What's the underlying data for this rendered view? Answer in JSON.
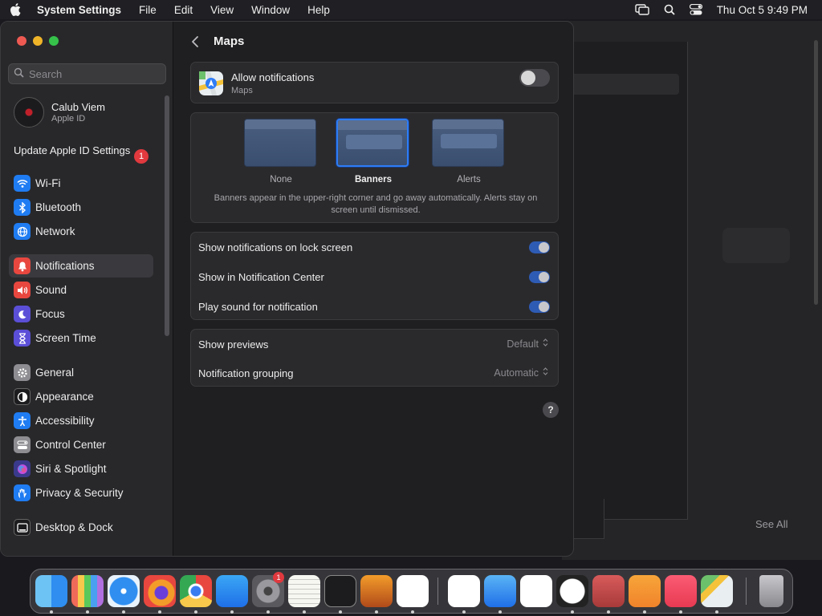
{
  "menubar": {
    "app_name": "System Settings",
    "menus": [
      "File",
      "Edit",
      "View",
      "Window",
      "Help"
    ],
    "clock": "Thu Oct 5  9:49 PM"
  },
  "background_window": {
    "see_all": "See All"
  },
  "sidebar": {
    "search_placeholder": "Search",
    "user": {
      "name": "Calub Viem",
      "subtitle": "Apple ID"
    },
    "update": {
      "label": "Update Apple ID Settings",
      "badge": "1"
    },
    "items": [
      {
        "label": "Wi-Fi",
        "icon": "wifi-icon",
        "color": "#1f7cf2"
      },
      {
        "label": "Bluetooth",
        "icon": "bluetooth-icon",
        "color": "#1f7cf2"
      },
      {
        "label": "Network",
        "icon": "globe-icon",
        "color": "#1f7cf2"
      },
      {
        "label": "Notifications",
        "icon": "bell-icon",
        "color": "#e8473f",
        "selected": true
      },
      {
        "label": "Sound",
        "icon": "speaker-icon",
        "color": "#e8473f"
      },
      {
        "label": "Focus",
        "icon": "moon-icon",
        "color": "#5b4fd8"
      },
      {
        "label": "Screen Time",
        "icon": "hourglass-icon",
        "color": "#5b4fd8"
      },
      {
        "label": "General",
        "icon": "gear-icon",
        "color": "#8e8e92"
      },
      {
        "label": "Appearance",
        "icon": "appearance-icon",
        "color": "#1c1c1e"
      },
      {
        "label": "Accessibility",
        "icon": "accessibility-icon",
        "color": "#1f7cf2"
      },
      {
        "label": "Control Center",
        "icon": "control-center-icon",
        "color": "#8e8e92"
      },
      {
        "label": "Siri & Spotlight",
        "icon": "siri-icon",
        "color": "#3a3a8c"
      },
      {
        "label": "Privacy & Security",
        "icon": "hand-icon",
        "color": "#1f7cf2"
      },
      {
        "label": "Desktop & Dock",
        "icon": "dock-icon",
        "color": "#1c1c1e"
      }
    ]
  },
  "content": {
    "title": "Maps",
    "allow": {
      "label": "Allow notifications",
      "app": "Maps",
      "enabled": false
    },
    "styles": {
      "options": [
        {
          "label": "None",
          "selected": false
        },
        {
          "label": "Banners",
          "selected": true
        },
        {
          "label": "Alerts",
          "selected": false
        }
      ],
      "description": "Banners appear in the upper-right corner and go away automatically. Alerts stay on screen until dismissed."
    },
    "toggles": [
      {
        "label": "Show notifications on lock screen",
        "on": true
      },
      {
        "label": "Show in Notification Center",
        "on": true
      },
      {
        "label": "Play sound for notification",
        "on": true
      }
    ],
    "popups": [
      {
        "label": "Show previews",
        "value": "Default"
      },
      {
        "label": "Notification grouping",
        "value": "Automatic"
      }
    ],
    "help": "?"
  },
  "dock": {
    "apps": [
      "finder-icon",
      "launchpad-icon",
      "safari-icon",
      "firefox-icon",
      "chrome-icon",
      "app-store-icon",
      "system-settings-icon",
      "textedit-icon",
      "terminal-icon",
      "garageband-icon",
      "vscode-icon",
      "visual-studio-icon",
      "icloud-icon",
      "freeform-icon",
      "clock-icon",
      "dictionary-icon",
      "books-icon",
      "music-icon",
      "maps-icon",
      "trash-icon"
    ],
    "settings_badge": "1"
  }
}
